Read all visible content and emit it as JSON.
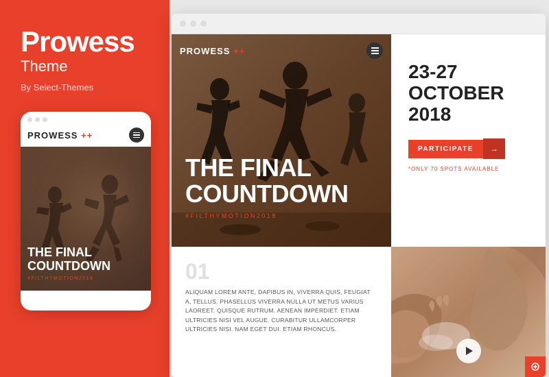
{
  "leftPanel": {
    "title": "Prowess",
    "subtitle": "Theme",
    "byline": "By Select-Themes",
    "mobileMockup": {
      "dots": [
        "dot1",
        "dot2",
        "dot3"
      ],
      "logo": "PROWESS",
      "logoSuffix": "++",
      "heroTitle": "THE FINAL\nCOUNTDOWN",
      "hashtag": "#FILTHYMOTION2018"
    }
  },
  "browser": {
    "dots": [
      "red",
      "yellow",
      "green"
    ],
    "hero": {
      "logo": "PROWESS",
      "logoSuffix": "++",
      "mainTitle": "THE FINAL\nCOUNTDOWN",
      "hashtag": "#FILTHYMOTION2018"
    },
    "info": {
      "date": "23-27\nOCTOBER 2018",
      "participateLabel": "PARTICIPATE",
      "participateArrow": "→",
      "spotsText": "*ONLY 70 SPOTS AVAILABLE"
    },
    "content": {
      "sectionNumber": "01",
      "paragraph": "ALIQUAM LOREM ANTE, DAPIBUS IN, VIVERRA QUIS, FEUGIAT A, TELLUS. PHASELLUS VIVERRA NULLA UT METUS VARIUS LAOREET. QUISQUE RUTRUM. AENEAN IMPERDIET. ETIAM ULTRICIES NISI VEL AUGUE. CURABITUR ULLAMCORPER ULTRICIES NISI. NAM EGET DUI. ETIAM RHONCUS."
    },
    "colors": {
      "accent": "#e8402a",
      "dark": "#222222",
      "light": "#ffffff"
    }
  }
}
